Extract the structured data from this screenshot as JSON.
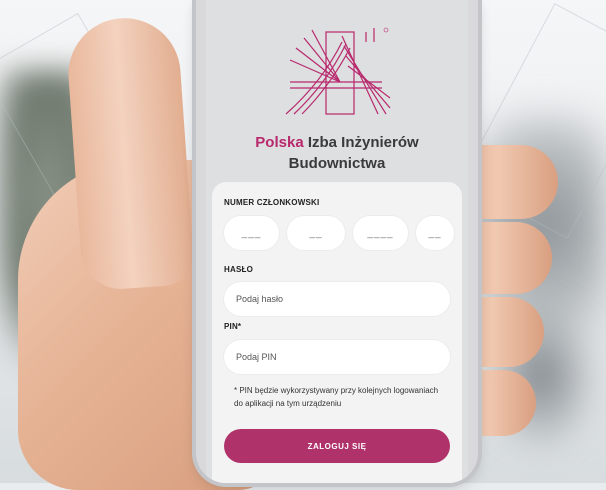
{
  "organization": {
    "name_accent": "Polska",
    "name_rest": "Izba Inżynierów",
    "name_line2": "Budownictwa"
  },
  "colors": {
    "brand": "#b0326b",
    "brand_text": "#b8286c"
  },
  "login_form": {
    "member_number_label": "NUMER CZŁONKOWSKI",
    "member_number_segments": [
      "___",
      "__",
      "____",
      "__"
    ],
    "password_label": "HASŁO",
    "password_placeholder": "Podaj hasło",
    "pin_label": "PIN*",
    "pin_placeholder": "Podaj PIN",
    "pin_note": "* PIN będzie wykorzystywany przy kolejnych logowaniach do aplikacji na tym urządzeniu",
    "login_button": "ZALOGUJ SIĘ"
  },
  "icons": {
    "logo": "bridge-logo-icon"
  }
}
